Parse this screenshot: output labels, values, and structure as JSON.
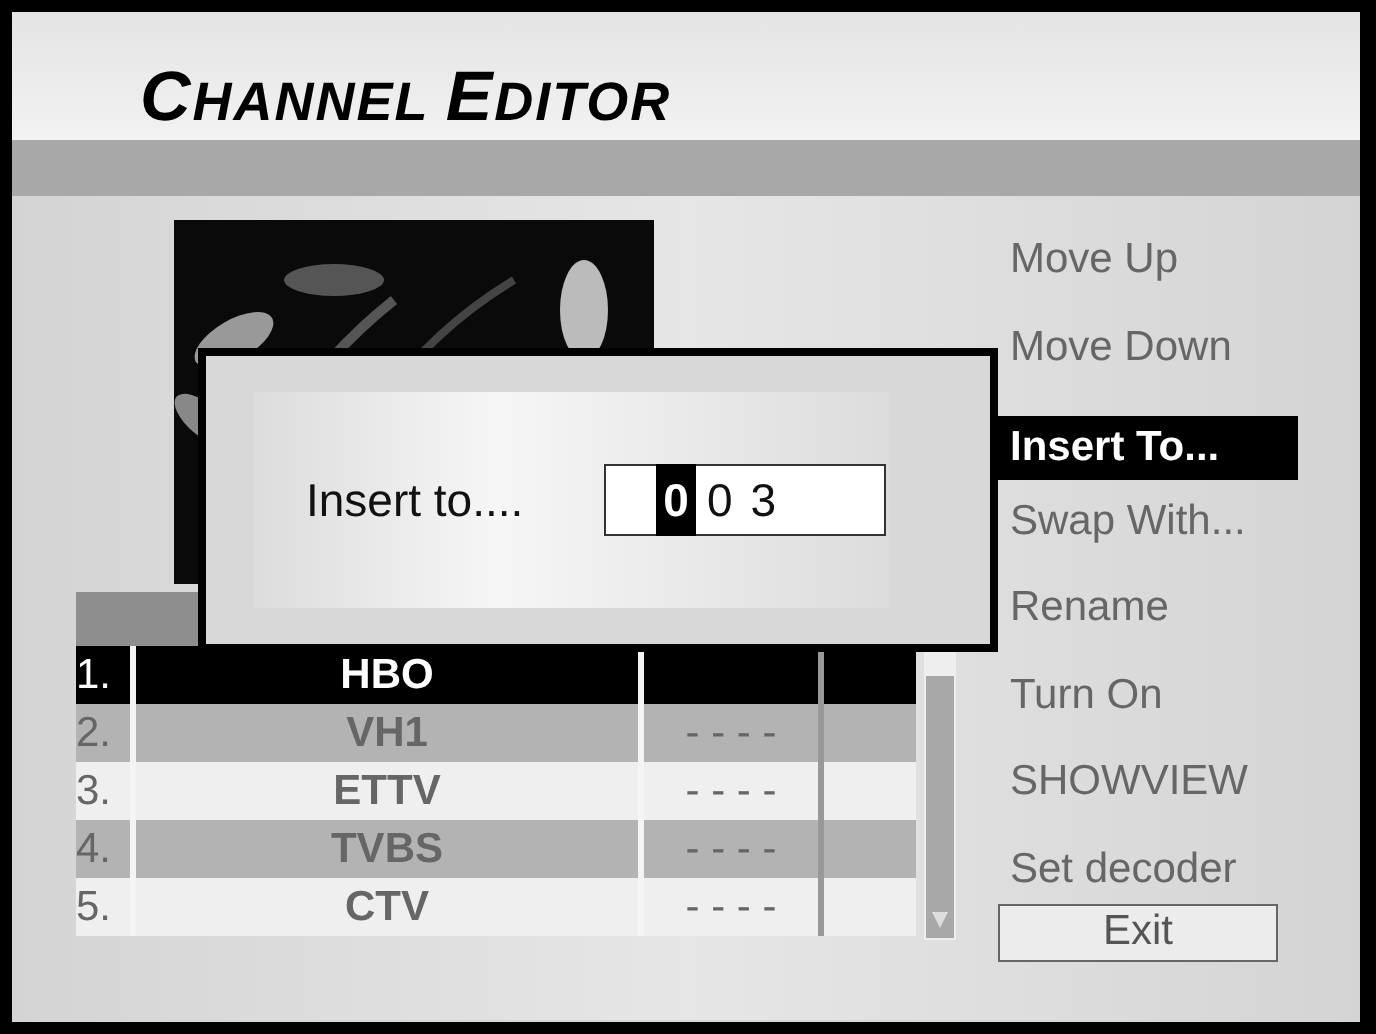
{
  "title": "CHANNEL EDITOR",
  "channels": [
    {
      "number": "1.",
      "name": "HBO",
      "selected": true
    },
    {
      "number": "2.",
      "name": "VH1",
      "column_3": "- - - -",
      "selected": false
    },
    {
      "number": "3.",
      "name": "ETTV",
      "column_3": "- - - -",
      "selected": false
    },
    {
      "number": "4.",
      "name": "TVBS",
      "column_3": "- - - -",
      "selected": false
    },
    {
      "number": "5.",
      "name": "CTV",
      "column_3": "- - - -",
      "selected": false
    }
  ],
  "menu": [
    {
      "label": "Move Up",
      "selected": false
    },
    {
      "label": "Move Down",
      "selected": false
    },
    {
      "label": "Insert To...",
      "selected": true
    },
    {
      "label": "Swap With...",
      "selected": false
    },
    {
      "label": "Rename",
      "selected": false
    },
    {
      "label": "Turn On",
      "selected": false
    },
    {
      "label": "SHOWVIEW",
      "selected": false
    },
    {
      "label": "Set decoder",
      "selected": false
    }
  ],
  "exit_button": "Exit",
  "dialog": {
    "label": "Insert to....",
    "digits": [
      {
        "digit": "0",
        "selected": true
      },
      {
        "digit": "0",
        "selected": false
      },
      {
        "digit": "3",
        "selected": false
      }
    ]
  }
}
